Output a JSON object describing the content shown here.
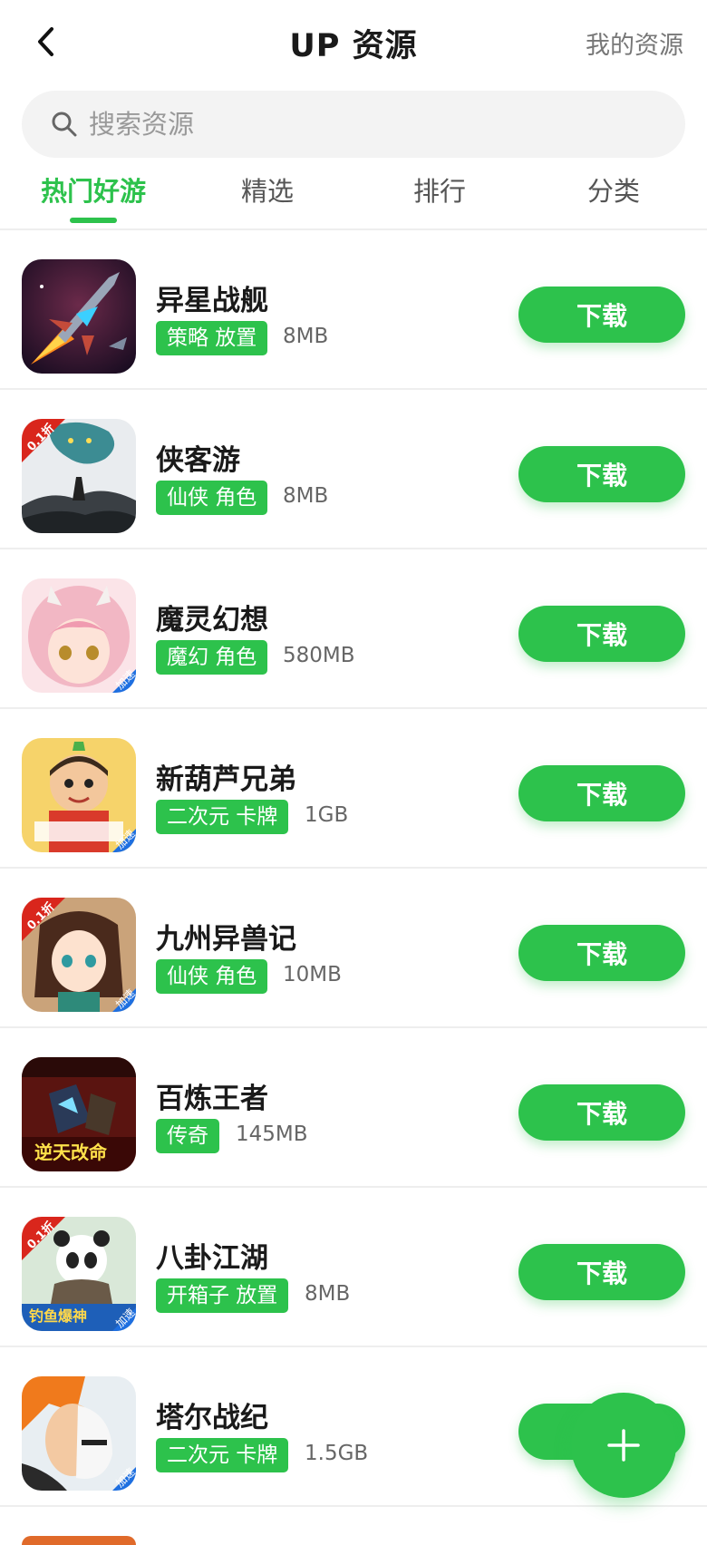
{
  "header": {
    "title": "UP 资源",
    "right_link": "我的资源"
  },
  "search": {
    "placeholder": "搜索资源"
  },
  "tabs": [
    {
      "label": "热门好游",
      "active": true
    },
    {
      "label": "精选",
      "active": false
    },
    {
      "label": "排行",
      "active": false
    },
    {
      "label": "分类",
      "active": false
    }
  ],
  "download_label": "下载",
  "games": [
    {
      "name": "异星战舰",
      "tag": "策略 放置",
      "size": "8MB",
      "icon": "spaceship-game-icon"
    },
    {
      "name": "侠客游",
      "tag": "仙侠 角色",
      "size": "8MB",
      "icon": "dragon-swordsman-game-icon",
      "badge": "0.1折"
    },
    {
      "name": "魔灵幻想",
      "tag": "魔幻 角色",
      "size": "580MB",
      "icon": "anime-girl-game-icon",
      "badge2": "加速"
    },
    {
      "name": "新葫芦兄弟",
      "tag": "二次元 卡牌",
      "size": "1GB",
      "icon": "calabash-brother-game-icon",
      "badge2": "加速"
    },
    {
      "name": "九州异兽记",
      "tag": "仙侠 角色",
      "size": "10MB",
      "icon": "anime-heroine-game-icon",
      "badge": "0.1折",
      "badge2": "加速"
    },
    {
      "name": "百炼王者",
      "tag": "传奇",
      "size": "145MB",
      "icon": "legend-warrior-game-icon",
      "banner": "逆天改命"
    },
    {
      "name": "八卦江湖",
      "tag": "开箱子 放置",
      "size": "8MB",
      "icon": "panda-game-icon",
      "badge": "0.1折",
      "badge2": "加速",
      "banner": "钓鱼爆神"
    },
    {
      "name": "塔尔战纪",
      "tag": "二次元 卡牌",
      "size": "1.5GB",
      "icon": "masked-warrior-game-icon",
      "badge2": "加速"
    }
  ],
  "colors": {
    "accent": "#2dc24c",
    "text": "#1a1a1a",
    "muted": "#777777"
  }
}
